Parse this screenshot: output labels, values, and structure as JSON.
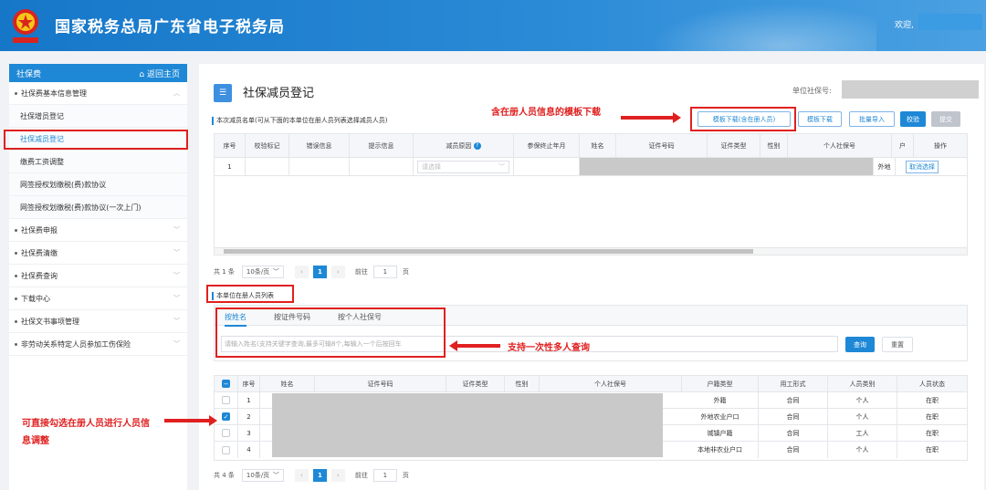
{
  "header": {
    "title": "国家税务总局广东省电子税务局",
    "welcome": "欢迎,"
  },
  "sidebar": {
    "head": "社保费",
    "home": "返回主页",
    "items": [
      {
        "label": "社保费基本信息管理"
      },
      {
        "label": "社保增员登记"
      },
      {
        "label": "社保减员登记"
      },
      {
        "label": "缴费工资调整"
      },
      {
        "label": "网签授权划缴税(费)款协议"
      },
      {
        "label": "网签授权划缴税(费)款协议(一次上门)"
      },
      {
        "label": "社保费申报"
      },
      {
        "label": "社保费清缴"
      },
      {
        "label": "社保费查询"
      },
      {
        "label": "下载中心"
      },
      {
        "label": "社保文书事项管理"
      },
      {
        "label": "非劳动关系特定人员参加工伤保险"
      }
    ]
  },
  "page": {
    "title": "社保减员登记",
    "unit_label": "单位社保号:"
  },
  "section1": {
    "label": "本次减员名单(可从下面的本单位在册人员列表选择减员人员)"
  },
  "buttons": {
    "template_with_staff": "模板下载(含在册人员)",
    "template": "模板下载",
    "batch_import": "批量导入",
    "verify": "校验",
    "submit": "提交"
  },
  "table1": {
    "headers": [
      "序号",
      "校验标记",
      "错误信息",
      "提示信息",
      "减员原因",
      "参保终止年月",
      "姓名",
      "证件号码",
      "证件类型",
      "性别",
      "个人社保号",
      "户",
      "操作"
    ],
    "row": {
      "index": "1",
      "reason_placeholder": "请选择",
      "hukou": "外地",
      "action": "取消选择"
    }
  },
  "pager1": {
    "total": "共 1 条",
    "size": "10条/页",
    "page": "1",
    "goto": "前往",
    "goto_value": "1",
    "unit": "页"
  },
  "section2": {
    "label": "本单位在册人员列表"
  },
  "tabs": [
    "按姓名",
    "按证件号码",
    "按个人社保号"
  ],
  "search": {
    "placeholder": "请输入姓名(支持关键字查询,最多可输8个,每输入一个后按回车",
    "query": "查询",
    "reset": "重置"
  },
  "table2": {
    "headers": [
      "序号",
      "姓名",
      "证件号码",
      "证件类型",
      "性别",
      "个人社保号",
      "户籍类型",
      "用工形式",
      "人员类别",
      "人员状态"
    ],
    "rows": [
      {
        "index": "1",
        "hukou": "外籍",
        "form": "合同",
        "category": "个人",
        "status": "在职",
        "checked": false
      },
      {
        "index": "2",
        "hukou": "外地农业户口",
        "form": "合同",
        "category": "个人",
        "status": "在职",
        "checked": true
      },
      {
        "index": "3",
        "hukou": "城镇户籍",
        "form": "合同",
        "category": "工人",
        "status": "在职",
        "checked": false
      },
      {
        "index": "4",
        "hukou": "本地非农业户口",
        "form": "合同",
        "category": "个人",
        "status": "在职",
        "checked": false
      }
    ]
  },
  "pager2": {
    "total": "共 4 条",
    "size": "10条/页",
    "page": "1",
    "goto": "前往",
    "goto_value": "1",
    "unit": "页"
  },
  "annotations": {
    "template": "含在册人员信息的模板下载",
    "multi_query": "支持一次性多人查询",
    "check_adjust_1": "可直接勾选在册人员进行人员信",
    "check_adjust_2": "息调整"
  },
  "colors": {
    "accent": "#1e88d6",
    "annotation": "#e02020"
  }
}
